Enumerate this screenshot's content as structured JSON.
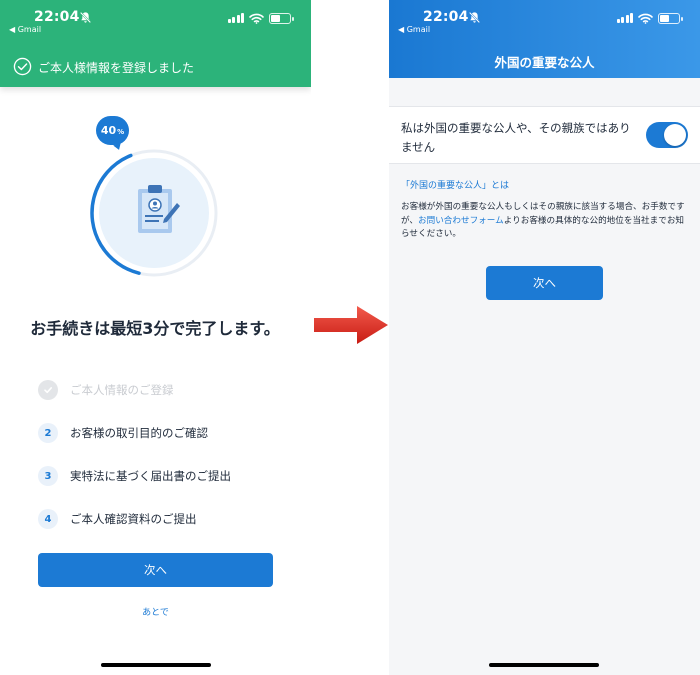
{
  "status": {
    "time": "22:04",
    "back_app": "◀ Gmail"
  },
  "left_screen": {
    "toast_message": "ご本人様情報を登録しました",
    "progress_value": "40",
    "progress_unit": "%",
    "progress_fraction": 0.4,
    "title": "お手続きは最短3分で完了します。",
    "steps": [
      {
        "number": "",
        "label": "ご本人情報のご登録",
        "state": "done"
      },
      {
        "number": "2",
        "label": "お客様の取引目的のご確認",
        "state": "pending"
      },
      {
        "number": "3",
        "label": "実特法に基づく届出書のご提出",
        "state": "pending"
      },
      {
        "number": "4",
        "label": "ご本人確認資料のご提出",
        "state": "pending"
      }
    ],
    "next_label": "次へ",
    "later_label": "あとで"
  },
  "right_screen": {
    "header_title": "外国の重要な公人",
    "toggle_label": "私は外国の重要な公人や、その親族ではありません",
    "toggle_on": true,
    "info_link": "「外国の重要な公人」とは",
    "info_text_1": "お客様が外国の重要な公人もしくはその親族に該当する場合、お手数ですが、",
    "info_inline_link": "お問い合わせフォーム",
    "info_text_2": "よりお客様の具体的な公的地位を当社までお知らせください。",
    "next_label": "次へ"
  },
  "colors": {
    "toast_green": "#2cb37a",
    "primary_blue": "#1c7ad4",
    "header_gradient_start": "#1a78d2",
    "header_gradient_end": "#3b98e8",
    "arrow_red": "#e52a1f"
  },
  "icons": [
    "bell-slash-icon",
    "cellular-signal-icon",
    "wifi-icon",
    "battery-icon",
    "check-circle-icon",
    "clipboard-user-icon",
    "check-icon",
    "arrow-right-icon"
  ]
}
